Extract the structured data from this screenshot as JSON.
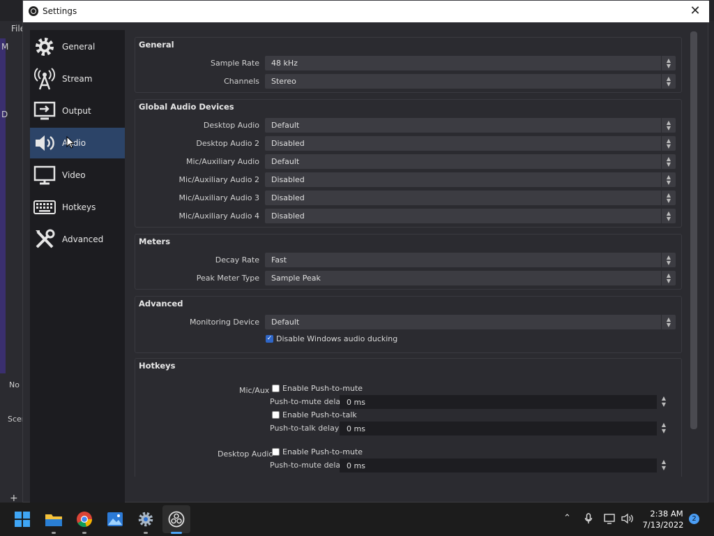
{
  "window": {
    "title": "Settings",
    "close_glyph": "✕"
  },
  "background_app": {
    "menu_file": "File",
    "left_m": "M",
    "left_d": "D",
    "no_source_text": "No s",
    "scenes_text": "Scen",
    "add_glyph": "+"
  },
  "sidebar": {
    "items": [
      {
        "label": "General",
        "icon": "gear-icon"
      },
      {
        "label": "Stream",
        "icon": "antenna-icon"
      },
      {
        "label": "Output",
        "icon": "output-monitor-icon"
      },
      {
        "label": "Audio",
        "icon": "speaker-icon"
      },
      {
        "label": "Video",
        "icon": "monitor-icon"
      },
      {
        "label": "Hotkeys",
        "icon": "keyboard-icon"
      },
      {
        "label": "Advanced",
        "icon": "tools-icon"
      }
    ],
    "active": "Audio"
  },
  "general": {
    "title": "General",
    "sample_rate_label": "Sample Rate",
    "sample_rate_value": "48 kHz",
    "channels_label": "Channels",
    "channels_value": "Stereo"
  },
  "global_audio": {
    "title": "Global Audio Devices",
    "rows": [
      {
        "label": "Desktop Audio",
        "value": "Default"
      },
      {
        "label": "Desktop Audio 2",
        "value": "Disabled"
      },
      {
        "label": "Mic/Auxiliary Audio",
        "value": "Default"
      },
      {
        "label": "Mic/Auxiliary Audio 2",
        "value": "Disabled"
      },
      {
        "label": "Mic/Auxiliary Audio 3",
        "value": "Disabled"
      },
      {
        "label": "Mic/Auxiliary Audio 4",
        "value": "Disabled"
      }
    ]
  },
  "meters": {
    "title": "Meters",
    "decay_label": "Decay Rate",
    "decay_value": "Fast",
    "peak_label": "Peak Meter Type",
    "peak_value": "Sample Peak"
  },
  "advanced": {
    "title": "Advanced",
    "monitoring_label": "Monitoring Device",
    "monitoring_value": "Default",
    "ducking_label": "Disable Windows audio ducking",
    "ducking_checked": true
  },
  "hotkeys": {
    "title": "Hotkeys",
    "mic_aux": {
      "label": "Mic/Aux",
      "ptm_label": "Enable Push-to-mute",
      "ptm_delay_label": "Push-to-mute delay",
      "ptm_delay_value": "0 ms",
      "ptt_label": "Enable Push-to-talk",
      "ptt_delay_label": "Push-to-talk delay",
      "ptt_delay_value": "0 ms"
    },
    "desktop_audio": {
      "label": "Desktop Audio",
      "ptm_label": "Enable Push-to-mute",
      "ptm_delay_label": "Push-to-mute delay",
      "ptm_delay_value": "0 ms"
    }
  },
  "taskbar": {
    "apps": [
      "start-icon",
      "file-explorer-icon",
      "chrome-icon",
      "photos-icon",
      "settings-icon",
      "obs-icon"
    ],
    "time": "2:38 AM",
    "date": "7/13/2022",
    "notifications": "2"
  }
}
